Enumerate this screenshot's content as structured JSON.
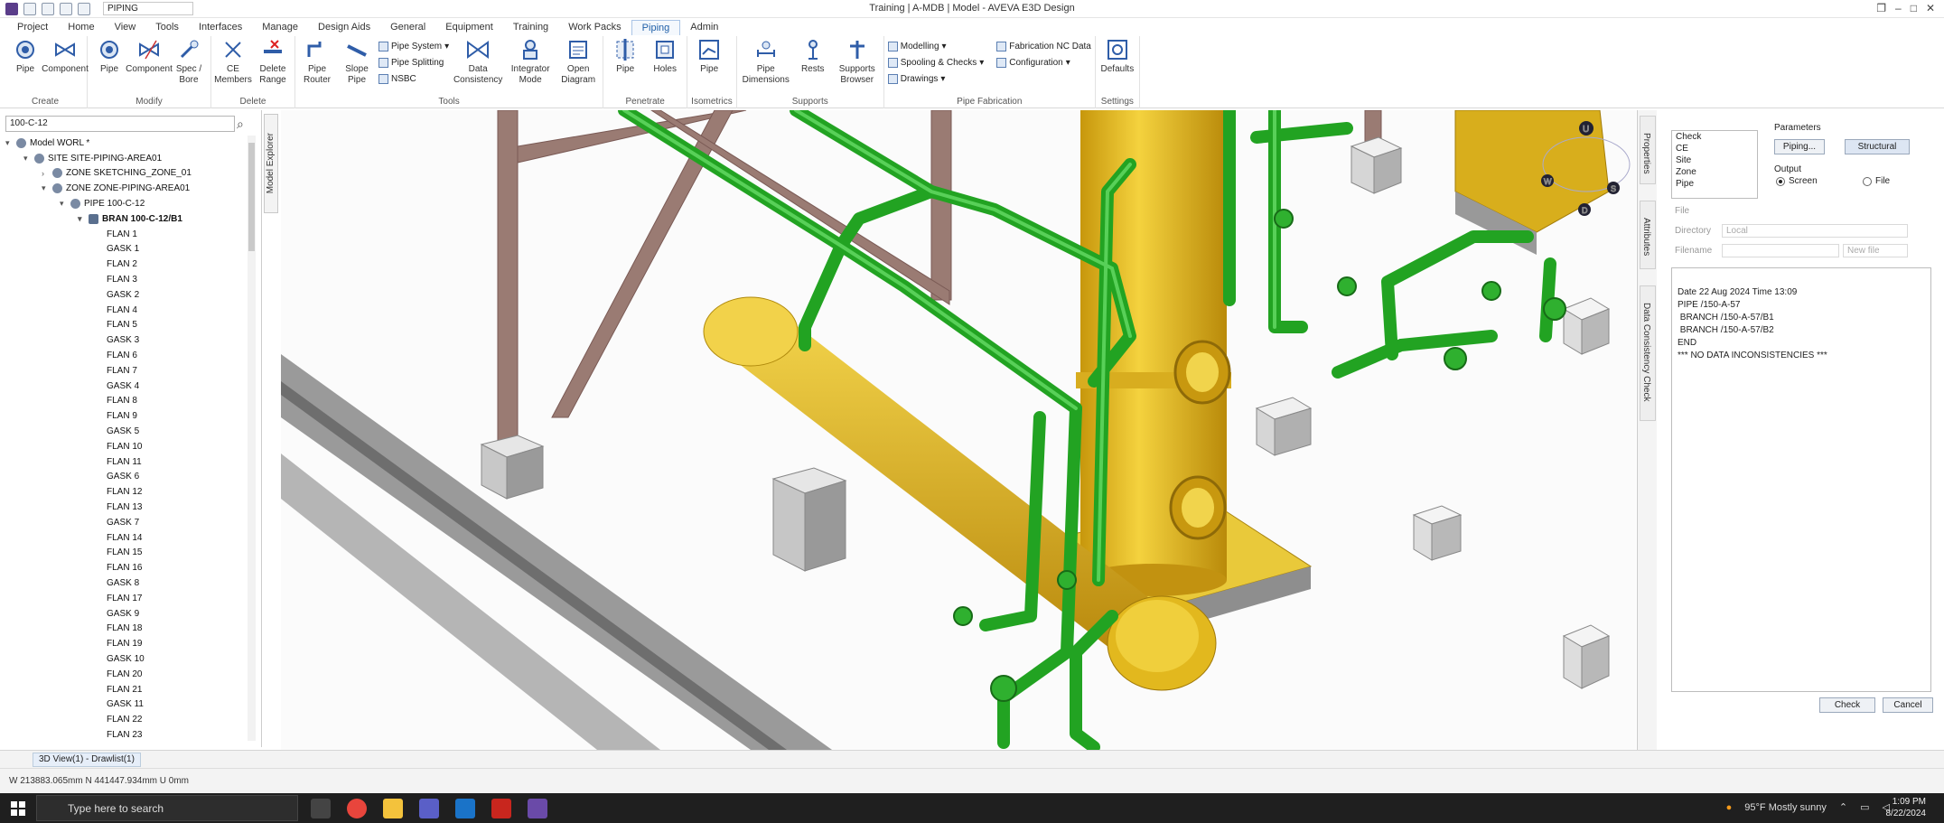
{
  "app": {
    "window_title": "Training | A-MDB | Model - AVEVA E3D Design",
    "module_select": "PIPING"
  },
  "menu": [
    "Project",
    "Home",
    "View",
    "Tools",
    "Interfaces",
    "Manage",
    "Design Aids",
    "General",
    "Equipment",
    "Training",
    "Work Packs",
    "Piping",
    "Admin"
  ],
  "ribbon": {
    "create": {
      "name": "Create",
      "pipe": "Pipe",
      "component": "Component"
    },
    "modify": {
      "name": "Modify",
      "pipe": "Pipe",
      "component": "Component",
      "spec_bore": "Spec /\nBore"
    },
    "delete": {
      "name": "Delete",
      "ce_members": "CE\nMembers",
      "delete_range": "Delete\nRange"
    },
    "tools": {
      "name": "Tools",
      "pipe_router": "Pipe\nRouter",
      "slope_pipe": "Slope\nPipe",
      "pipe_system": "Pipe System",
      "pipe_splitting": "Pipe Splitting",
      "nsbc": "NSBC",
      "data_consistency": "Data\nConsistency",
      "integrator_mode": "Integrator\nMode",
      "open_diagram": "Open\nDiagram"
    },
    "penetrate": {
      "name": "Penetrate",
      "pipe": "Pipe",
      "holes": "Holes"
    },
    "isometrics": {
      "name": "Isometrics",
      "pipe": "Pipe"
    },
    "supports": {
      "name": "Supports",
      "pipe_dimensions": "Pipe\nDimensions",
      "rests": "Rests",
      "supports_browser": "Supports\nBrowser"
    },
    "pipe_fabrication": {
      "name": "Pipe Fabrication",
      "modelling": "Modelling",
      "spooling": "Spooling & Checks",
      "drawings": "Drawings",
      "fab_nc": "Fabrication NC Data",
      "configuration": "Configuration"
    },
    "settings": {
      "name": "Settings",
      "defaults": "Defaults"
    }
  },
  "explorer": {
    "search_value": "100-C-12",
    "tab_label": "Model Explorer",
    "tree": [
      {
        "label": "Model WORL *",
        "level": 0,
        "exp": "▾"
      },
      {
        "label": "SITE SITE-PIPING-AREA01",
        "level": 1,
        "exp": "▾"
      },
      {
        "label": "ZONE SKETCHING_ZONE_01",
        "level": 2,
        "exp": "›"
      },
      {
        "label": "ZONE ZONE-PIPING-AREA01",
        "level": 2,
        "exp": "▾"
      },
      {
        "label": "PIPE 100-C-12",
        "level": 3,
        "exp": "▾"
      },
      {
        "label": "BRAN 100-C-12/B1",
        "level": 4,
        "exp": "▾",
        "sel": true
      },
      {
        "label": "FLAN 1",
        "level": 5
      },
      {
        "label": "GASK 1",
        "level": 5
      },
      {
        "label": "FLAN 2",
        "level": 5
      },
      {
        "label": "FLAN 3",
        "level": 5
      },
      {
        "label": "GASK 2",
        "level": 5
      },
      {
        "label": "FLAN 4",
        "level": 5
      },
      {
        "label": "FLAN 5",
        "level": 5
      },
      {
        "label": "GASK 3",
        "level": 5
      },
      {
        "label": "FLAN 6",
        "level": 5
      },
      {
        "label": "FLAN 7",
        "level": 5
      },
      {
        "label": "GASK 4",
        "level": 5
      },
      {
        "label": "FLAN 8",
        "level": 5
      },
      {
        "label": "FLAN 9",
        "level": 5
      },
      {
        "label": "GASK 5",
        "level": 5
      },
      {
        "label": "FLAN 10",
        "level": 5
      },
      {
        "label": "FLAN 11",
        "level": 5
      },
      {
        "label": "GASK 6",
        "level": 5
      },
      {
        "label": "FLAN 12",
        "level": 5
      },
      {
        "label": "FLAN 13",
        "level": 5
      },
      {
        "label": "GASK 7",
        "level": 5
      },
      {
        "label": "FLAN 14",
        "level": 5
      },
      {
        "label": "FLAN 15",
        "level": 5
      },
      {
        "label": "FLAN 16",
        "level": 5
      },
      {
        "label": "GASK 8",
        "level": 5
      },
      {
        "label": "FLAN 17",
        "level": 5
      },
      {
        "label": "GASK 9",
        "level": 5
      },
      {
        "label": "FLAN 18",
        "level": 5
      },
      {
        "label": "FLAN 19",
        "level": 5
      },
      {
        "label": "GASK 10",
        "level": 5
      },
      {
        "label": "FLAN 20",
        "level": 5
      },
      {
        "label": "FLAN 21",
        "level": 5
      },
      {
        "label": "GASK 11",
        "level": 5
      },
      {
        "label": "FLAN 22",
        "level": 5
      },
      {
        "label": "FLAN 23",
        "level": 5
      }
    ]
  },
  "right_tabs": {
    "properties": "Properties",
    "attributes": "Attributes",
    "data_consistency": "Data Consistency Check"
  },
  "dcc": {
    "check_list": [
      "Check",
      "CE",
      "Site",
      "Zone",
      "Pipe"
    ],
    "parameters_label": "Parameters",
    "piping_btn": "Piping...",
    "structural_btn": "Structural",
    "output_label": "Output",
    "screen_label": "Screen",
    "file_label": "File",
    "file_section": "File",
    "directory_label": "Directory",
    "directory_value": "Local",
    "filename_label": "Filename",
    "newfile_value": "New file",
    "report": [
      "Date 22 Aug 2024 Time 13:09",
      "PIPE /150-A-57",
      " BRANCH /150-A-57/B1",
      " BRANCH /150-A-57/B2",
      "END",
      "*** NO DATA INCONSISTENCIES ***"
    ],
    "check_btn": "Check",
    "cancel_btn": "Cancel"
  },
  "viewtab": "3D View(1) - Drawlist(1)",
  "status": {
    "coords": "W 213883.065mm N 441447.934mm U 0mm"
  },
  "taskbar": {
    "search_placeholder": "Type here to search",
    "weather": "95°F  Mostly sunny",
    "time": "1:09 PM",
    "date": "8/22/2024"
  },
  "colors": {
    "pipe_green": "#2db82d",
    "vessel_yellow": "#e8b91a",
    "steel": "#8a6a62",
    "accent": "#1f5fa8"
  }
}
